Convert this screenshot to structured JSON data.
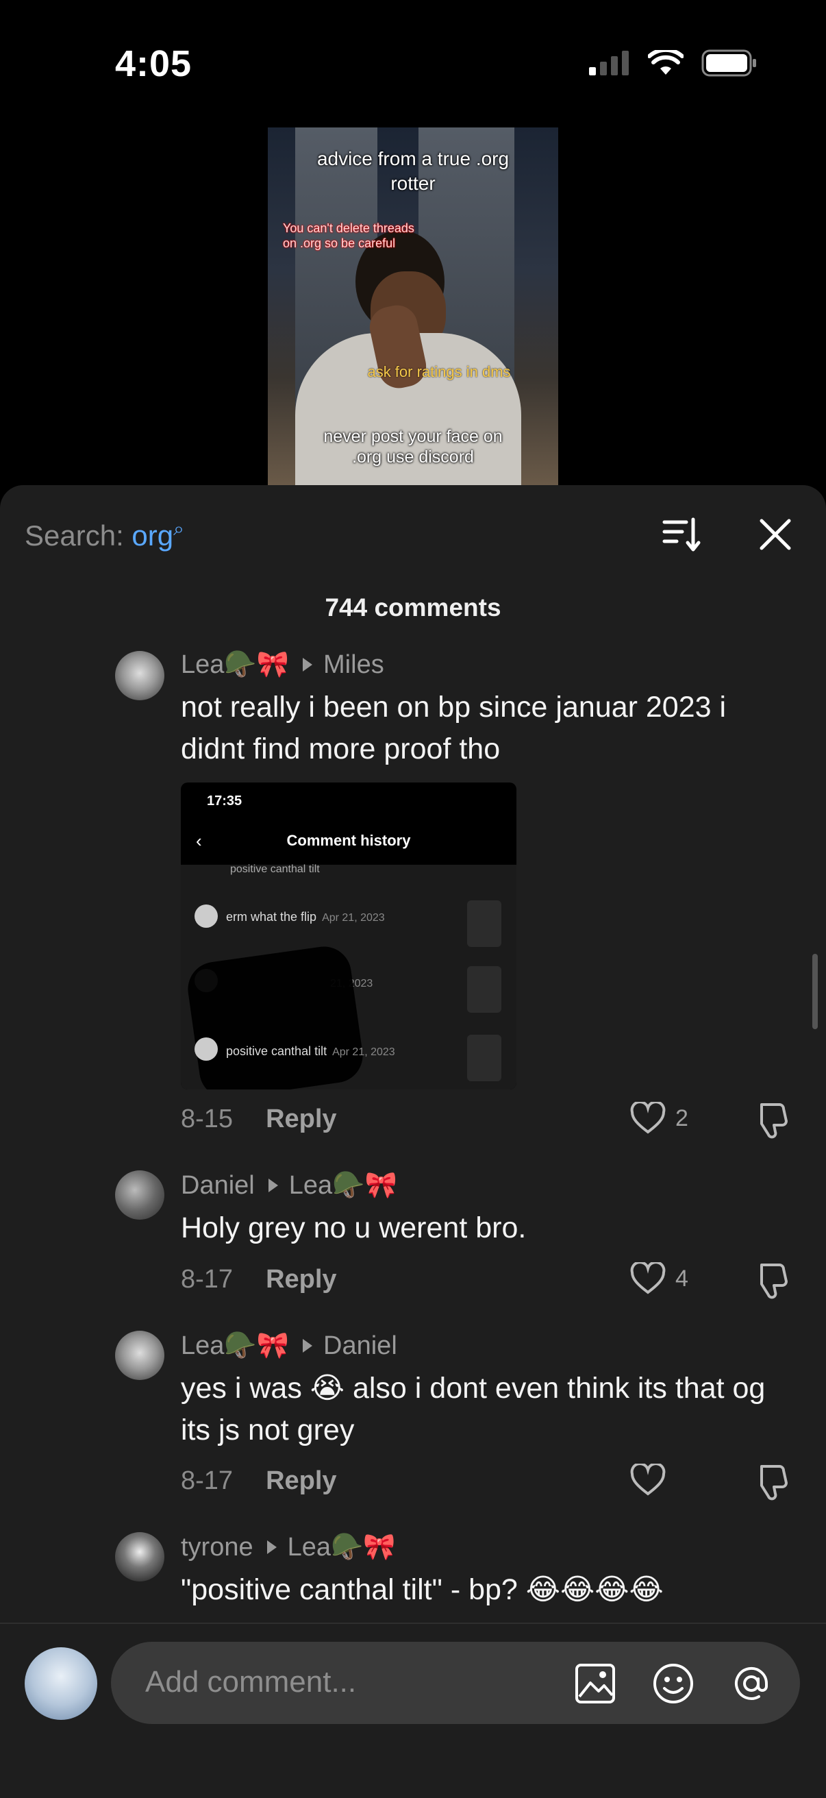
{
  "status": {
    "time": "4:05"
  },
  "video": {
    "caption_top": "advice from a true .org rotter",
    "caption_pink": "You can't delete threads on .org so be careful",
    "caption_yellow": "ask for ratings in dms",
    "caption_bottom": "never post your face on .org use discord"
  },
  "sheet": {
    "search_label": "Search: ",
    "search_query": "org",
    "comments_count": "744 comments"
  },
  "comments": [
    {
      "author": "Lea🪖🎀",
      "reply_to": "Miles",
      "text": "not really i been on bp since januar 2023 i didnt find more proof tho",
      "date": "8-15",
      "reply_label": "Reply",
      "likes": "2",
      "screenshot": {
        "time": "17:35",
        "title": "Comment history",
        "items": [
          {
            "text": "positive canthal tilt",
            "date": ""
          },
          {
            "text": "erm what the flip",
            "date": "Apr 21, 2023"
          },
          {
            "text": "",
            "date": "21, 2023"
          },
          {
            "text": "positive canthal tilt",
            "date": "Apr 21, 2023"
          }
        ]
      }
    },
    {
      "author": "Daniel",
      "reply_to": "Lea🪖🎀",
      "text": "Holy grey no u werent bro.",
      "date": "8-17",
      "reply_label": "Reply",
      "likes": "4"
    },
    {
      "author": "Lea🪖🎀",
      "reply_to": "Daniel",
      "text": "yes i was 😭 also i dont even think its that og its js not grey",
      "date": "8-17",
      "reply_label": "Reply",
      "likes": ""
    },
    {
      "author": "tyrone",
      "reply_to": "Lea🪖🎀",
      "text": "\"positive canthal tilt\" - bp? 😂😂😂😂"
    }
  ],
  "composer": {
    "placeholder": "Add comment..."
  },
  "icons": [
    "signal-icon",
    "wifi-icon",
    "battery-icon",
    "sort-icon",
    "close-icon",
    "heart-icon",
    "dislike-icon",
    "image-icon",
    "emoji-icon",
    "mention-icon"
  ],
  "colors": {
    "accent": "#5aa8ff",
    "sheet_bg": "#1e1e1e",
    "input_bg": "#3a3a3a"
  }
}
